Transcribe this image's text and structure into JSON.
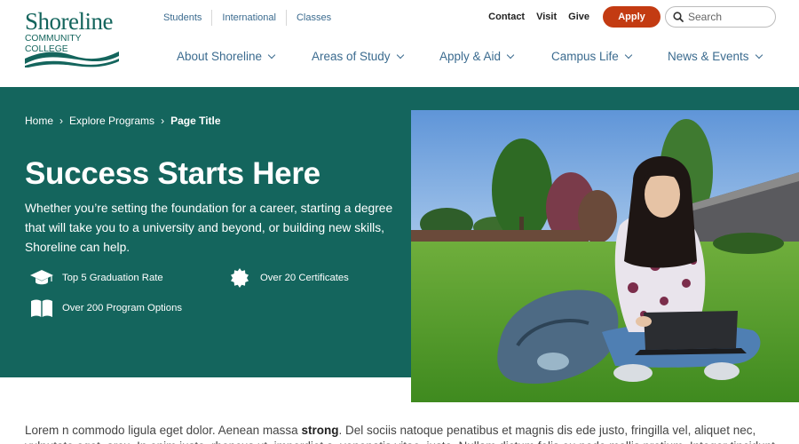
{
  "logo": {
    "name": "Shoreline",
    "subtitle": "COMMUNITY COLLEGE",
    "colors": {
      "teal": "#14655d"
    }
  },
  "utility_nav": {
    "left_links": [
      "Students",
      "International",
      "Classes"
    ],
    "right_links": [
      "Contact",
      "Visit",
      "Give"
    ],
    "apply_label": "Apply",
    "search_placeholder": "Search"
  },
  "main_nav": {
    "items": [
      "About Shoreline",
      "Areas of Study",
      "Apply & Aid",
      "Campus Life",
      "News & Events"
    ]
  },
  "breadcrumb": {
    "items": [
      "Home",
      "Explore Programs",
      "Page Title"
    ]
  },
  "hero": {
    "title": "Success Starts Here",
    "text": "Whether you’re setting the foundation for a career, starting a degree that will take you to a university and beyond, or building new skills, Shoreline can help.",
    "background": "#14655d",
    "features": [
      {
        "icon": "graduation-cap-icon",
        "label": "Top 5 Graduation Rate"
      },
      {
        "icon": "badge-icon",
        "label": "Over 20 Certificates"
      },
      {
        "icon": "book-icon",
        "label": "Over 200 Program Options"
      }
    ]
  },
  "body": {
    "intro_before": "Lorem n commodo ligula eget dolor. Aenean massa ",
    "intro_strong": "strong",
    "intro_after": ". Del sociis natoque penatibus et magnis dis ede justo, fringilla vel, aliquet nec,",
    "line2": "vulputate eget, arcu. In enim justo, rhoncus ut, imperdiet a, venenatis vitae, justo. Nullam dictum felis eu pede mollis pretium. Integer tincidunt."
  },
  "colors": {
    "apply_button": "#c33b12",
    "link_blue": "#3b6b8f"
  }
}
